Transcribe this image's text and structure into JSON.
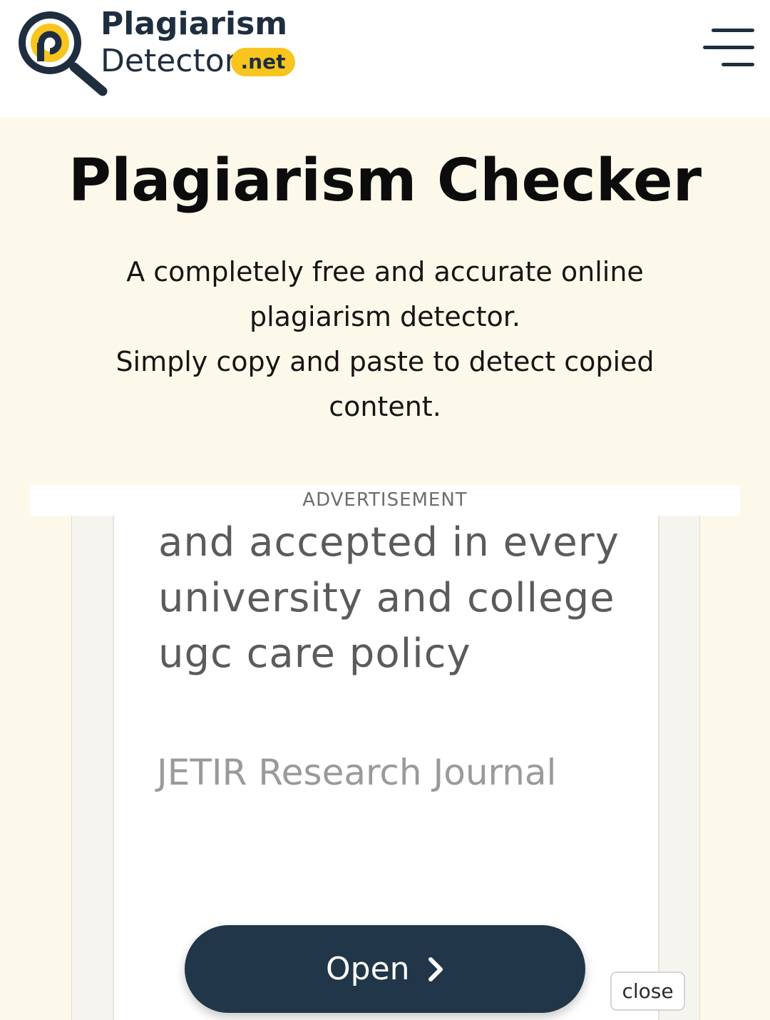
{
  "header": {
    "logo_line1": "Plagiarism",
    "logo_line2": "Detector",
    "logo_tld": ".net",
    "menu_icon": "hamburger-menu-icon"
  },
  "hero": {
    "title": "Plagiarism Checker",
    "subtitle_lines": [
      "A completely free and accurate online",
      "plagiarism detector.",
      "Simply copy and paste to detect copied",
      "content."
    ]
  },
  "advertisement": {
    "label": "ADVERTISEMENT",
    "text_lines": [
      "and accepted in every",
      "university and college",
      "ugc care policy"
    ],
    "journal": "JETIR Research Journal",
    "open_label": "Open",
    "open_icon": "chevron-right-icon",
    "close_label": "close"
  },
  "colors": {
    "brand_dark": "#1f2e3f",
    "brand_yellow": "#f7c51e",
    "hero_background": "#fdf9ea",
    "open_button": "#213648"
  }
}
